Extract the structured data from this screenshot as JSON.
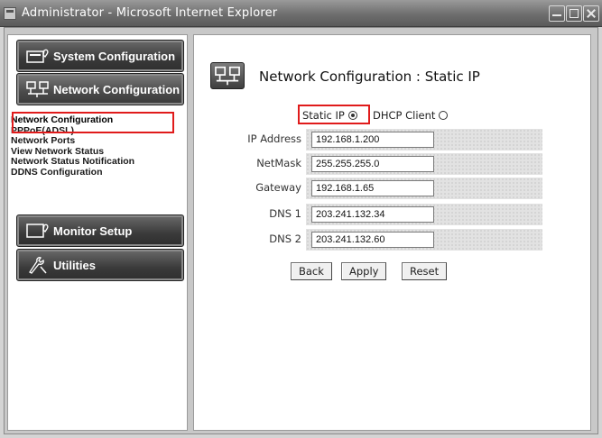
{
  "window": {
    "title": "Administrator - Microsoft Internet Explorer",
    "controls": [
      "minimize-icon",
      "maximize-icon",
      "close-icon"
    ]
  },
  "sidebar": {
    "menu": [
      {
        "label": "System Configuration",
        "icon": "system-config-icon"
      },
      {
        "label": "Network Configuration",
        "icon": "network-config-icon",
        "selected": true
      },
      {
        "label": "Monitor Setup",
        "icon": "monitor-setup-icon"
      },
      {
        "label": "Utilities",
        "icon": "utilities-icon"
      }
    ],
    "submenu": [
      "Network Configuration",
      "PPPoE(ADSL)",
      "Network Ports",
      "View Network Status",
      "Network Status Notification",
      "DDNS Configuration"
    ]
  },
  "main": {
    "title": "Network Configuration : Static IP",
    "mode": {
      "static_label": "Static IP",
      "dhcp_label": "DHCP Client",
      "selected": "Static IP"
    },
    "fields": [
      {
        "label": "IP Address",
        "value": "192.168.1.200"
      },
      {
        "label": "NetMask",
        "value": "255.255.255.0"
      },
      {
        "label": "Gateway",
        "value": "192.168.1.65"
      },
      {
        "label": "DNS 1",
        "value": "203.241.132.34"
      },
      {
        "label": "DNS 2",
        "value": "203.241.132.60"
      }
    ],
    "buttons": {
      "back": "Back",
      "apply": "Apply",
      "reset": "Reset"
    }
  },
  "colors": {
    "highlight": "#e01b1b",
    "menu_button": "#3a3a3a",
    "title_bar": "#6e6e6e"
  }
}
